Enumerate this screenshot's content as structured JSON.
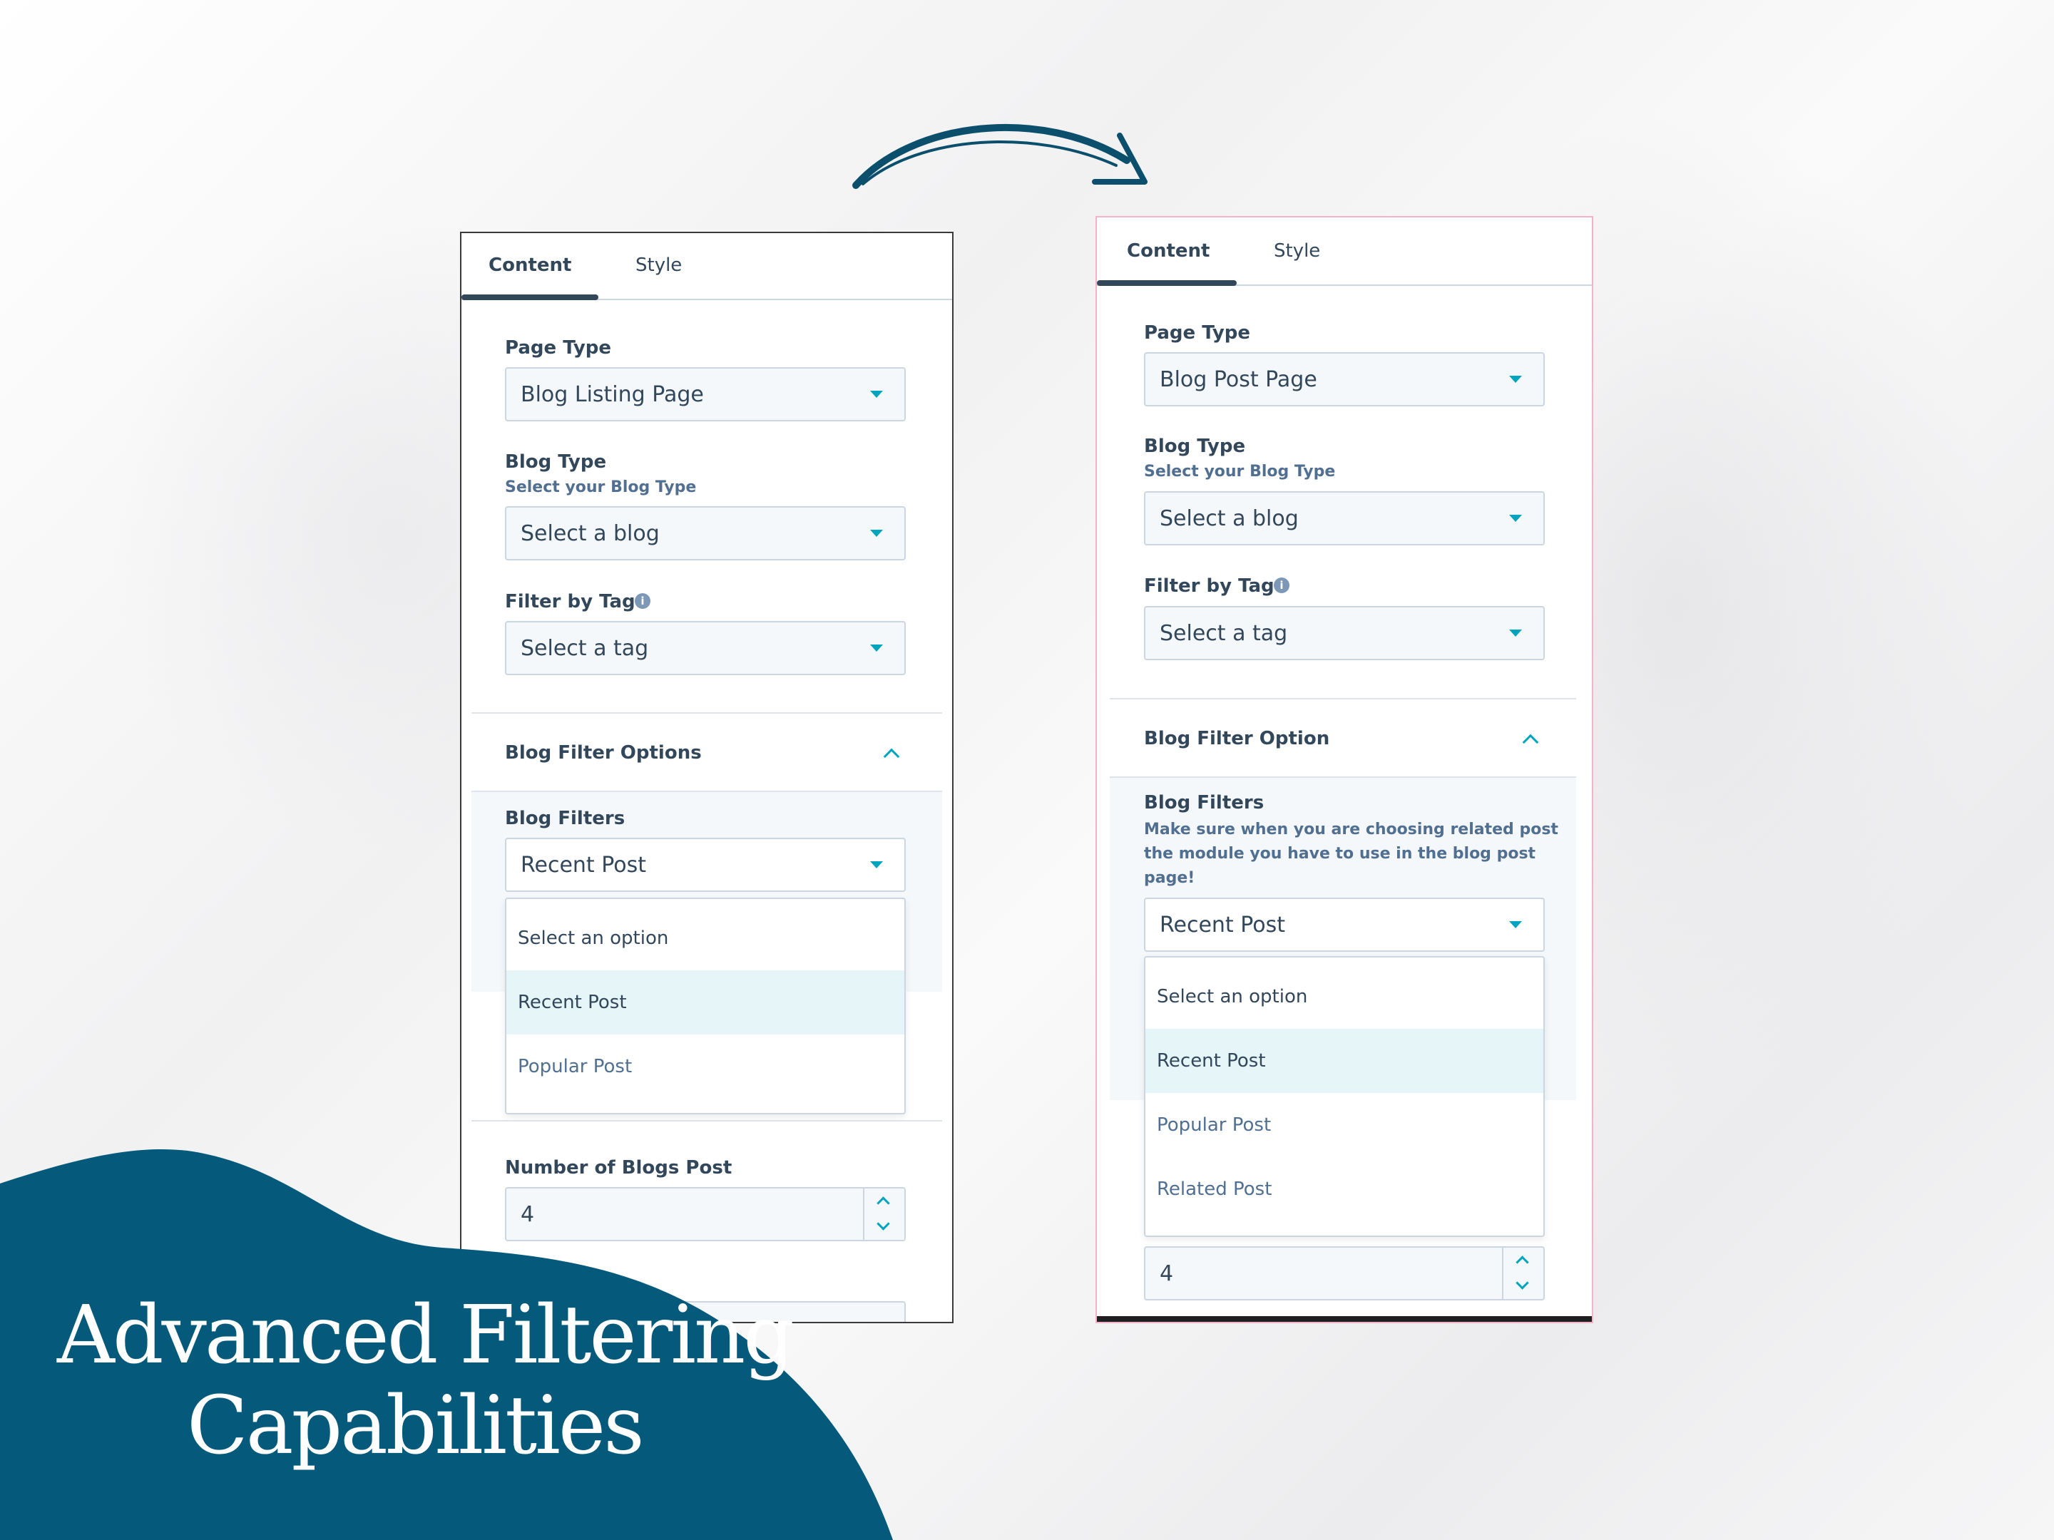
{
  "colors": {
    "brand_blue": "#055a7b",
    "accent_teal": "#00a4bd",
    "text_dark": "#33475b"
  },
  "headline": {
    "line1": "Advanced Filtering",
    "line2": "Capabilities"
  },
  "left_panel": {
    "tabs": [
      {
        "label": "Content",
        "active": true
      },
      {
        "label": "Style",
        "active": false
      }
    ],
    "page_type": {
      "label": "Page Type",
      "value": "Blog Listing Page"
    },
    "blog_type": {
      "label": "Blog Type",
      "help": "Select your Blog Type",
      "value": "Select a blog"
    },
    "filter_by_tag": {
      "label": "Filter by Tag",
      "info_icon": "info-icon",
      "value": "Select a tag"
    },
    "filter_section": {
      "title": "Blog Filter Options",
      "toggle_icon": "chevron-up-icon"
    },
    "blog_filters": {
      "label": "Blog Filters",
      "value": "Recent Post",
      "options": [
        "Select an option",
        "Recent Post",
        "Popular Post"
      ],
      "selected_option": "Recent Post"
    },
    "number_of_posts": {
      "label": "Number of Blogs Post",
      "value": "4"
    }
  },
  "right_panel": {
    "tabs": [
      {
        "label": "Content",
        "active": true
      },
      {
        "label": "Style",
        "active": false
      }
    ],
    "page_type": {
      "label": "Page Type",
      "value": "Blog Post Page"
    },
    "blog_type": {
      "label": "Blog Type",
      "help": "Select your Blog Type",
      "value": "Select a blog"
    },
    "filter_by_tag": {
      "label": "Filter by Tag",
      "info_icon": "info-icon",
      "value": "Select a tag"
    },
    "filter_section": {
      "title": "Blog Filter Option",
      "toggle_icon": "chevron-up-icon"
    },
    "blog_filters": {
      "label": "Blog Filters",
      "help_line1": "Make sure when you are choosing related post",
      "help_line2": "the module you have to use in the blog post",
      "help_line3": "page!",
      "value": "Recent Post",
      "options": [
        "Select an option",
        "Recent Post",
        "Popular Post",
        "Related Post"
      ],
      "selected_option": "Recent Post"
    },
    "number_of_posts": {
      "value": "4"
    }
  },
  "decorations": {
    "arrow_icon": "curved-arrow-icon"
  }
}
